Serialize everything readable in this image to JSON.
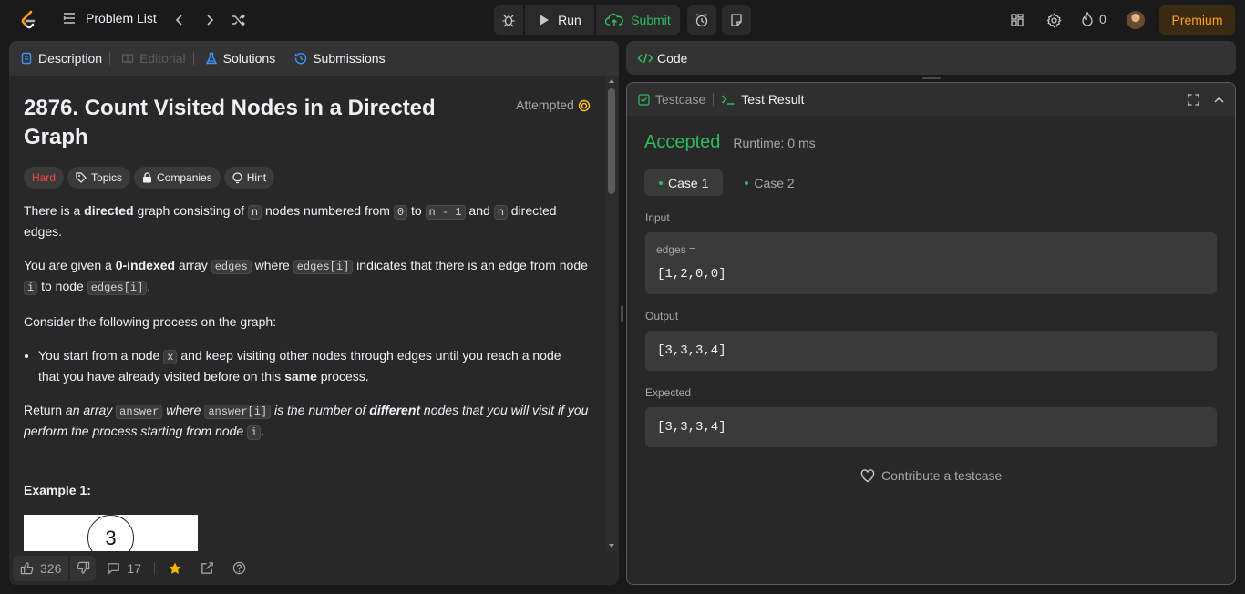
{
  "topbar": {
    "problem_list": "Problem List",
    "run": "Run",
    "submit": "Submit",
    "streak": "0",
    "premium": "Premium"
  },
  "left_tabs": {
    "description": "Description",
    "editorial": "Editorial",
    "solutions": "Solutions",
    "submissions": "Submissions"
  },
  "problem": {
    "title_line1": "2876. Count Visited Nodes in a Directed",
    "title_line2": "Graph",
    "status": "Attempted",
    "difficulty": "Hard",
    "topics": "Topics",
    "companies": "Companies",
    "hint": "Hint",
    "p1": {
      "a": "There is a ",
      "b": "directed",
      "c": " graph consisting of ",
      "code1": "n",
      "d": " nodes numbered from ",
      "code2": "0",
      "e": " to ",
      "code3": "n - 1",
      "f": " and ",
      "code4": "n",
      "g": " directed edges."
    },
    "p2": {
      "a": "You are given a ",
      "b": "0-indexed",
      "c": " array ",
      "code1": "edges",
      "d": " where ",
      "code2": "edges[i]",
      "e": " indicates that there is an edge from node ",
      "code3": "i",
      "f": " to node ",
      "code4": "edges[i]",
      "g": "."
    },
    "p3": "Consider the following process on the graph:",
    "li": {
      "a": "You start from a node ",
      "code1": "x",
      "b": " and keep visiting other nodes through edges until you reach a node that you have already visited before on this ",
      "c": "same",
      "d": " process."
    },
    "p4": {
      "a": "Return ",
      "b": "an array ",
      "code1": "answer",
      "c": " where ",
      "code2": "answer[i]",
      "d": " is the number of ",
      "e": "different",
      "f": " nodes that you will visit if you perform the process starting from node ",
      "code3": "i",
      "g": "."
    },
    "example_title": "Example 1:",
    "example_node": "3"
  },
  "footer": {
    "likes": "326",
    "comments": "17"
  },
  "code_panel": {
    "title": "Code"
  },
  "result_panel": {
    "testcase_tab": "Testcase",
    "result_tab": "Test Result",
    "verdict": "Accepted",
    "runtime": "Runtime: 0 ms",
    "case1": "Case 1",
    "case2": "Case 2",
    "input_label": "Input",
    "input_var": "edges =",
    "input_value": "[1,2,0,0]",
    "output_label": "Output",
    "output_value": "[3,3,3,4]",
    "expected_label": "Expected",
    "expected_value": "[3,3,3,4]",
    "contribute": "Contribute a testcase"
  },
  "colors": {
    "accent_green": "#2cbb5d",
    "hard_red": "#ef4743",
    "premium": "#ffa116"
  }
}
